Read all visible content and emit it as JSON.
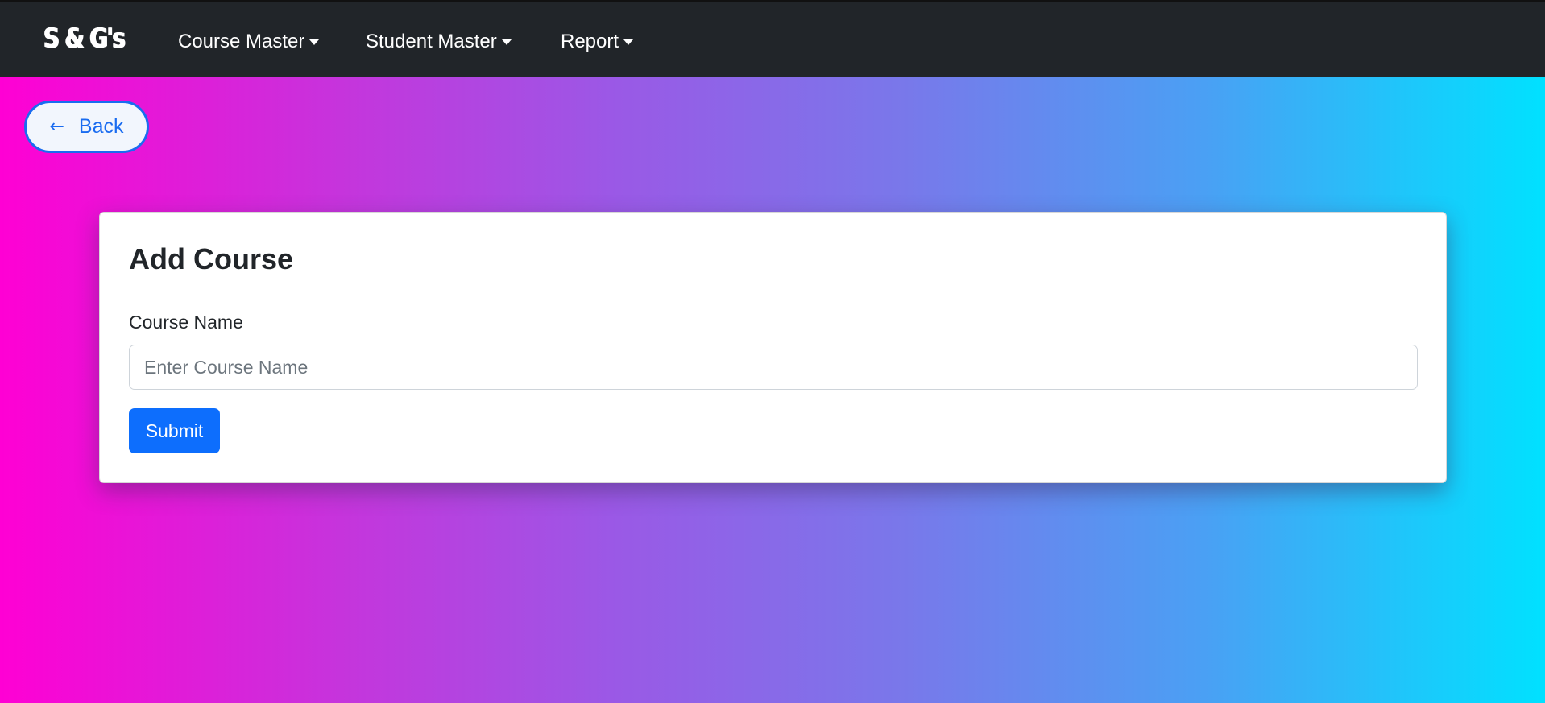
{
  "navbar": {
    "brand": "S & G's",
    "items": [
      {
        "label": "Course Master"
      },
      {
        "label": "Student Master"
      },
      {
        "label": "Report"
      }
    ]
  },
  "back_button": {
    "arrow": "←",
    "label": "Back"
  },
  "form": {
    "title": "Add Course",
    "course_name_label": "Course Name",
    "course_name_placeholder": "Enter Course Name",
    "course_name_value": "",
    "submit_label": "Submit"
  },
  "colors": {
    "navbar_bg": "#212529",
    "gradient_start": "#ff00d4",
    "gradient_end": "#00e1ff",
    "primary": "#0d6efd",
    "back_accent": "#1a6cf0"
  },
  "icons": {
    "dropdown": "caret-down-icon",
    "back": "left-arrow-icon"
  }
}
